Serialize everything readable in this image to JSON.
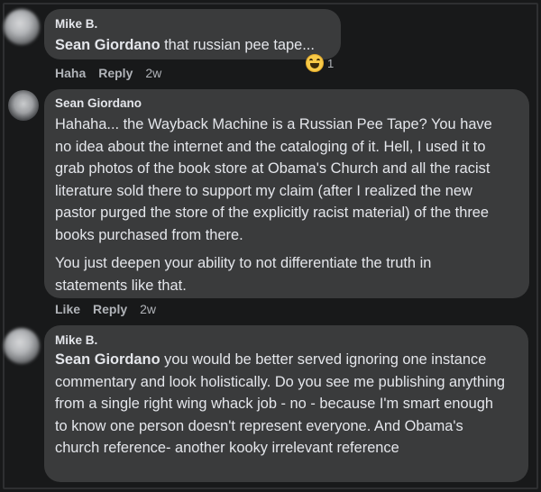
{
  "comments": [
    {
      "author": "Mike B.",
      "mention": "Sean Giordano",
      "text": " that russian pee tape...",
      "actions": [
        "Haha",
        "Reply"
      ],
      "time": "2w",
      "reaction_icon": "haha-emoji-icon",
      "reaction_count": "1"
    },
    {
      "author": "Sean Giordano",
      "paragraphs": [
        "Hahaha... the Wayback Machine is a Russian Pee Tape? You have no idea about the internet and the cataloging of it. Hell, I used it to grab photos of the book store at Obama's Church and all the racist literature sold there to support my claim (after I realized the new pastor purged the store of the explicitly racist material) of the three books purchased from there.",
        "You just deepen your ability to not differentiate the truth in statements like that."
      ],
      "actions": [
        "Like",
        "Reply"
      ],
      "time": "2w"
    },
    {
      "author": "Mike B.",
      "mention": "Sean Giordano",
      "text": " you would be better served ignoring one instance commentary and look holistically. Do you see me publishing anything from a single right wing whack job - no - because I'm smart enough to know one person doesn't represent everyone. And Obama's church reference- another kooky irrelevant reference"
    }
  ],
  "colors": {
    "background": "#18191a",
    "bubble": "#3a3b3c",
    "text": "#e4e6eb",
    "meta": "#b0b3b8"
  }
}
